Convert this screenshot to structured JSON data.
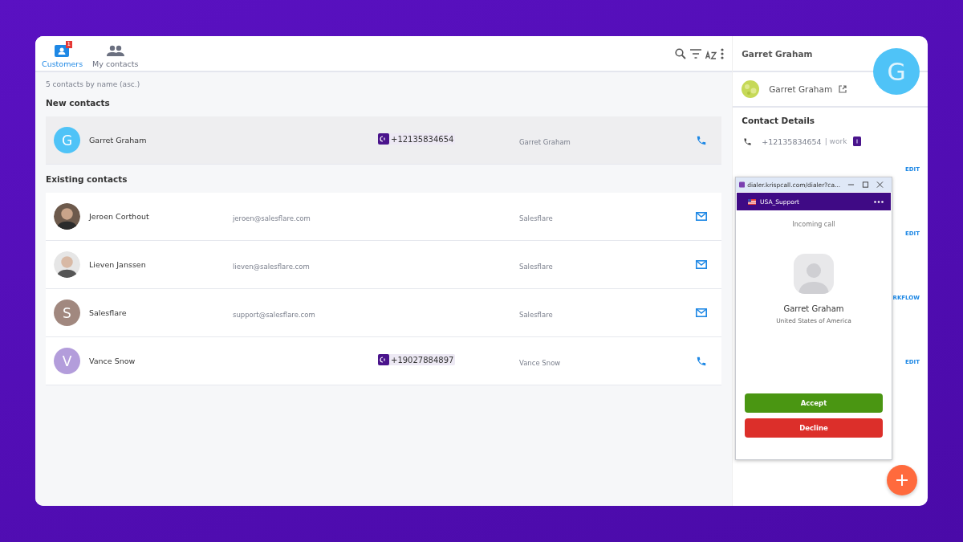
{
  "tabs": [
    {
      "label": "Customers",
      "selected": true,
      "badge": "1",
      "kind": "customers"
    },
    {
      "label": "My contacts",
      "selected": false,
      "kind": "group"
    }
  ],
  "list": {
    "summary": "5 contacts by name (asc.)",
    "sections": [
      {
        "title": "New contacts",
        "rows": [
          {
            "name": "Garret Graham",
            "avatar": {
              "kind": "letter",
              "letter": "G",
              "color": "#4fc3f7"
            },
            "email": "",
            "phone": "+12135834654",
            "account": "Garret Graham",
            "kind": "phone",
            "selected": true
          }
        ]
      },
      {
        "title": "Existing contacts",
        "rows": [
          {
            "name": "Jeroen Corthout",
            "email": "jeroen@salesflare.com",
            "phone": "",
            "account": "Salesflare",
            "kind": "email",
            "selected": false
          },
          {
            "name": "Lieven Janssen",
            "email": "lieven@salesflare.com",
            "phone": "",
            "account": "Salesflare",
            "kind": "email",
            "selected": false
          },
          {
            "name": "Salesflare",
            "avatar": {
              "kind": "letter",
              "letter": "S",
              "color": "#a1887f"
            },
            "email": "support@salesflare.com",
            "phone": "",
            "account": "Salesflare",
            "kind": "email",
            "selected": false
          },
          {
            "name": "Vance Snow",
            "avatar": {
              "kind": "letter",
              "letter": "V",
              "color": "#b39ddb"
            },
            "email": "",
            "phone": "+19027884897",
            "account": "Vance Snow",
            "kind": "phone",
            "selected": false
          }
        ]
      }
    ]
  },
  "detail": {
    "title": "Garret Graham",
    "avatar_letter": "G",
    "name": "Garret Graham",
    "section": "Contact Details",
    "phone": "+12135834654",
    "phone_type": "| work",
    "links": [
      "EDIT",
      "EDIT",
      "RKFLOW",
      "EDIT"
    ]
  },
  "dialer": {
    "url": "dialer.krispcall.com/dialer?ca...",
    "line": "USA_Support",
    "status": "Incoming call",
    "caller": "Garret Graham",
    "country": "United States of America",
    "buttons": [
      {
        "label": "Accept",
        "kind": "accept"
      },
      {
        "label": "Decline",
        "kind": "decline"
      }
    ]
  }
}
